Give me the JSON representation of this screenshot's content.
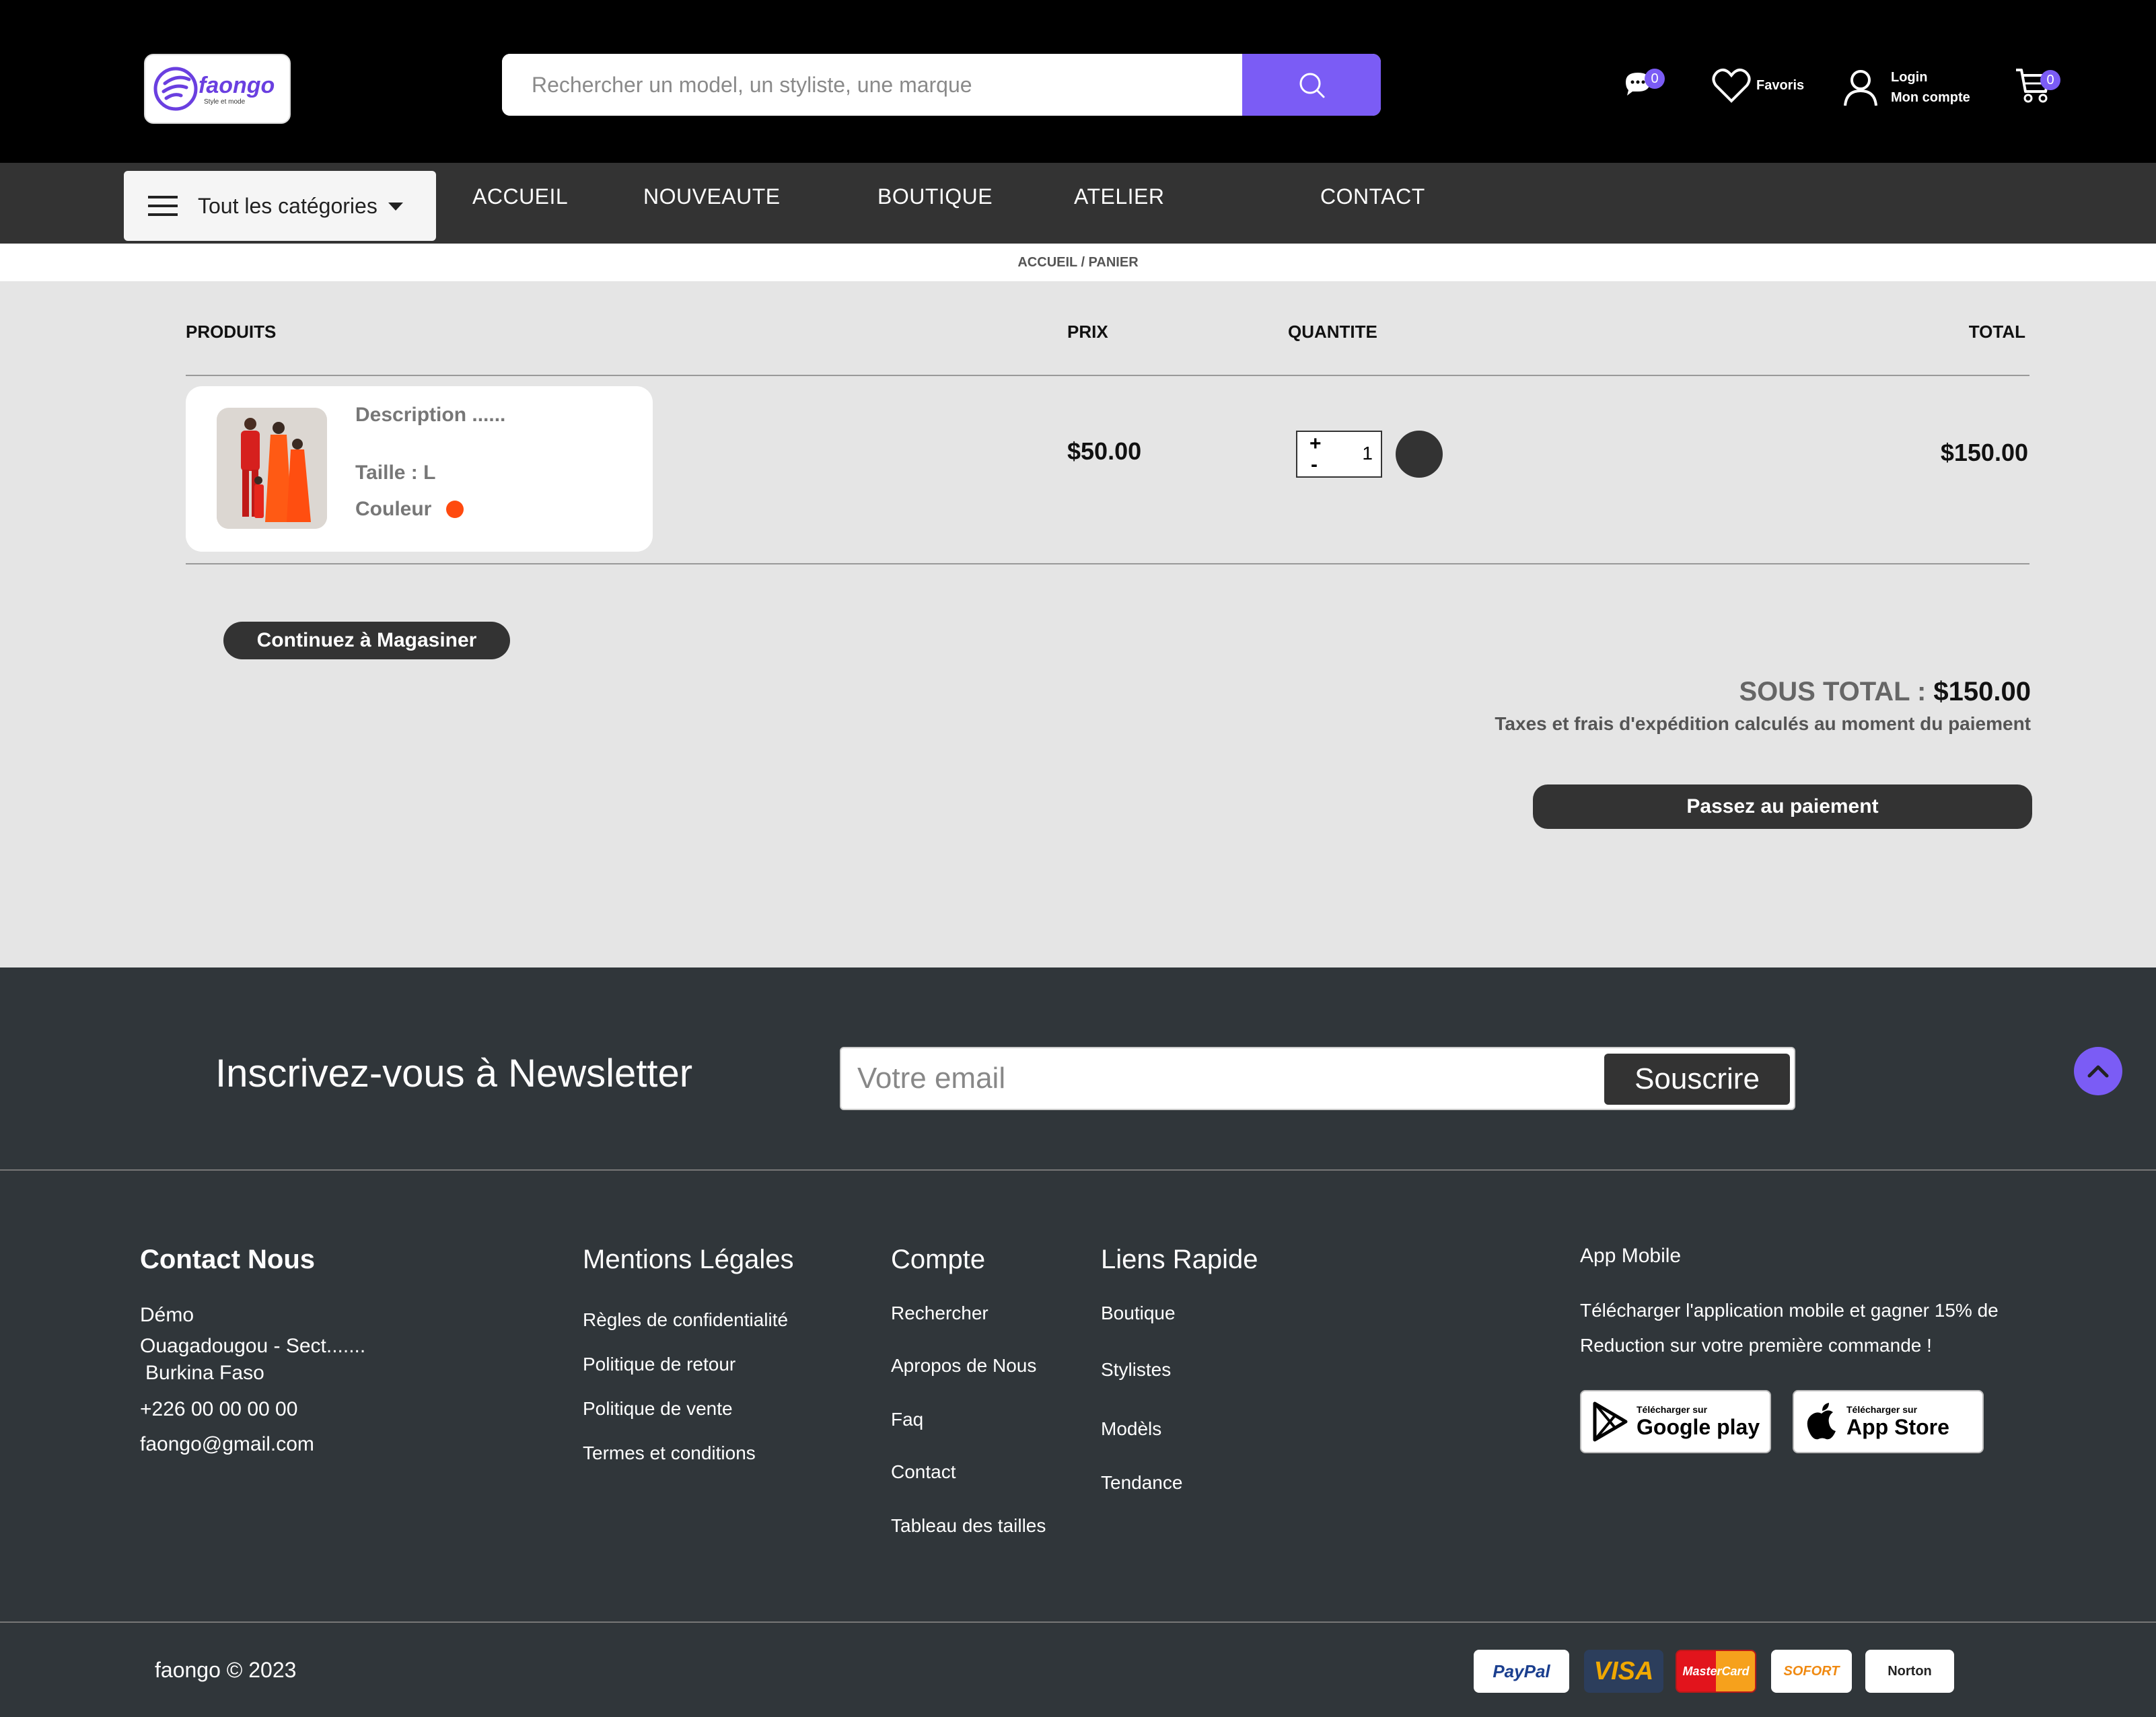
{
  "header": {
    "logo_text": "faongo",
    "logo_tagline": "Style et mode",
    "search_placeholder": "Rechercher un model, un styliste, une marque",
    "messages_count": "0",
    "favorites_label": "Favoris",
    "login_label": "Login",
    "account_label": "Mon compte",
    "cart_count": "0"
  },
  "nav": {
    "categories_label": "Tout les catégories",
    "links": [
      "ACCUEIL",
      "NOUVEAUTE",
      "BOUTIQUE",
      "ATELIER",
      "CONTACT"
    ]
  },
  "breadcrumb": "ACCUEIL / PANIER",
  "cart": {
    "headers": {
      "products": "PRODUITS",
      "price": "PRIX",
      "quantity": "QUANTITE",
      "total": "TOTAL"
    },
    "item": {
      "description": "Description ......",
      "size": "Taille : L",
      "color_label": "Couleur",
      "color": "#ff4a0f",
      "price": "$50.00",
      "plus": "+",
      "minus": "-",
      "quantity": "1",
      "total": "$150.00"
    },
    "continue_label": "Continuez à Magasiner",
    "subtotal_label": "SOUS TOTAL : ",
    "subtotal_value": "$150.00",
    "tax_note": "Taxes et frais d'expédition calculés au moment du paiement",
    "checkout_label": "Passez au paiement"
  },
  "newsletter": {
    "title": "Inscrivez-vous à Newsletter",
    "email_placeholder": "Votre email",
    "subscribe_label": "Souscrire"
  },
  "footer": {
    "contact": {
      "title": "Contact Nous",
      "lines": [
        "Démo",
        "Ouagadougou - Sect.......",
        "Burkina Faso",
        "+226 00 00 00 00",
        "faongo@gmail.com"
      ]
    },
    "legal": {
      "title": "Mentions Légales",
      "links": [
        "Règles de confidentialité",
        "Politique de retour",
        "Politique de vente",
        "Termes et conditions"
      ]
    },
    "account": {
      "title": "Compte",
      "links": [
        "Rechercher",
        "Apropos de Nous",
        "Faq",
        "Contact",
        "Tableau des tailles"
      ]
    },
    "quick": {
      "title": "Liens Rapide",
      "links": [
        "Boutique",
        "Stylistes",
        "Modèls",
        "Tendance"
      ]
    },
    "app": {
      "title": "App Mobile",
      "text": "Télécharger l'application mobile et gagner 15% de Reduction sur votre première commande !",
      "google_small": "Télécharger sur",
      "google_big": "Google play",
      "apple_small": "Télécharger sur",
      "apple_big": "App Store"
    },
    "copyright": "faongo © 2023",
    "payments": [
      "PayPal",
      "VISA",
      "MasterCard",
      "SOFORT",
      "Norton"
    ]
  },
  "colors": {
    "accent": "#7b5cf5",
    "dark": "#333333",
    "footer": "#30363a"
  }
}
